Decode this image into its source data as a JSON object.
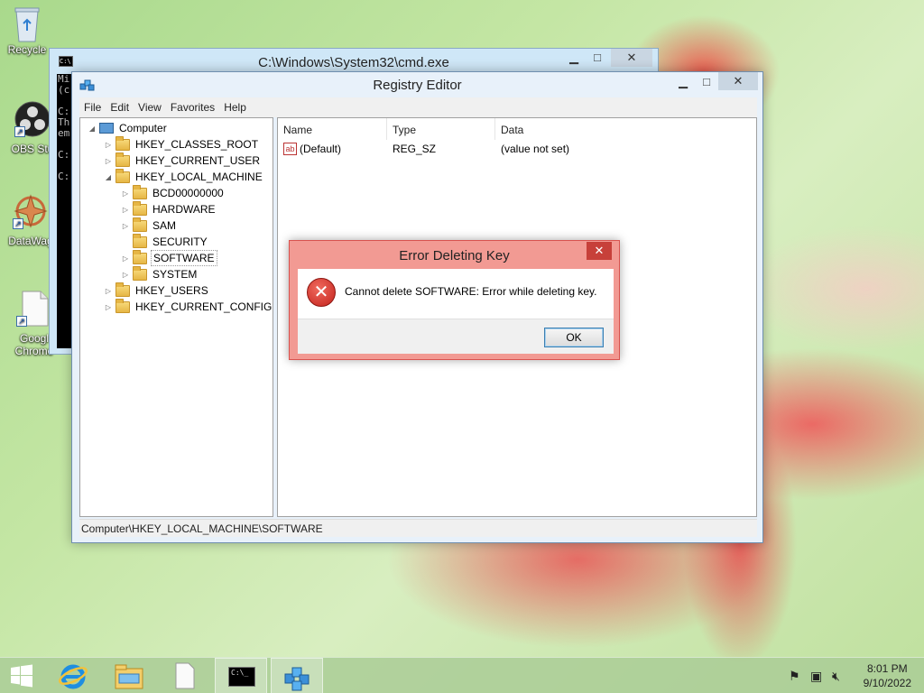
{
  "desktop": {
    "icons": [
      {
        "label": "Recycle"
      },
      {
        "label": "OBS Stu"
      },
      {
        "label": "DataWag"
      },
      {
        "label": "Googl\nChrome"
      }
    ]
  },
  "cmd": {
    "title": "C:\\Windows\\System32\\cmd.exe",
    "lines": [
      "Mi",
      "(c",
      "",
      "C:",
      "Th",
      "em",
      "",
      "C:",
      "",
      "C:"
    ]
  },
  "regedit": {
    "title": "Registry Editor",
    "menu": [
      "File",
      "Edit",
      "View",
      "Favorites",
      "Help"
    ],
    "tree": {
      "root": "Computer",
      "hkcr": "HKEY_CLASSES_ROOT",
      "hkcu": "HKEY_CURRENT_USER",
      "hklm": "HKEY_LOCAL_MACHINE",
      "bcd": "BCD00000000",
      "hardware": "HARDWARE",
      "sam": "SAM",
      "security": "SECURITY",
      "software": "SOFTWARE",
      "system": "SYSTEM",
      "hku": "HKEY_USERS",
      "hkcc": "HKEY_CURRENT_CONFIG"
    },
    "columns": {
      "name": "Name",
      "type": "Type",
      "data": "Data"
    },
    "values": [
      {
        "name": "(Default)",
        "type": "REG_SZ",
        "data": "(value not set)",
        "icon": "ab"
      }
    ],
    "status": "Computer\\HKEY_LOCAL_MACHINE\\SOFTWARE"
  },
  "dialog": {
    "title": "Error Deleting Key",
    "message": "Cannot delete SOFTWARE:  Error while deleting key.",
    "ok": "OK",
    "close_glyph": "✕",
    "icon_glyph": "✕"
  },
  "window_controls": {
    "minimize": "▁",
    "maximize": "□",
    "close": "✕"
  },
  "taskbar": {
    "time": "8:01 PM",
    "date": "9/10/2022",
    "cmd_label": "C:\\_"
  }
}
